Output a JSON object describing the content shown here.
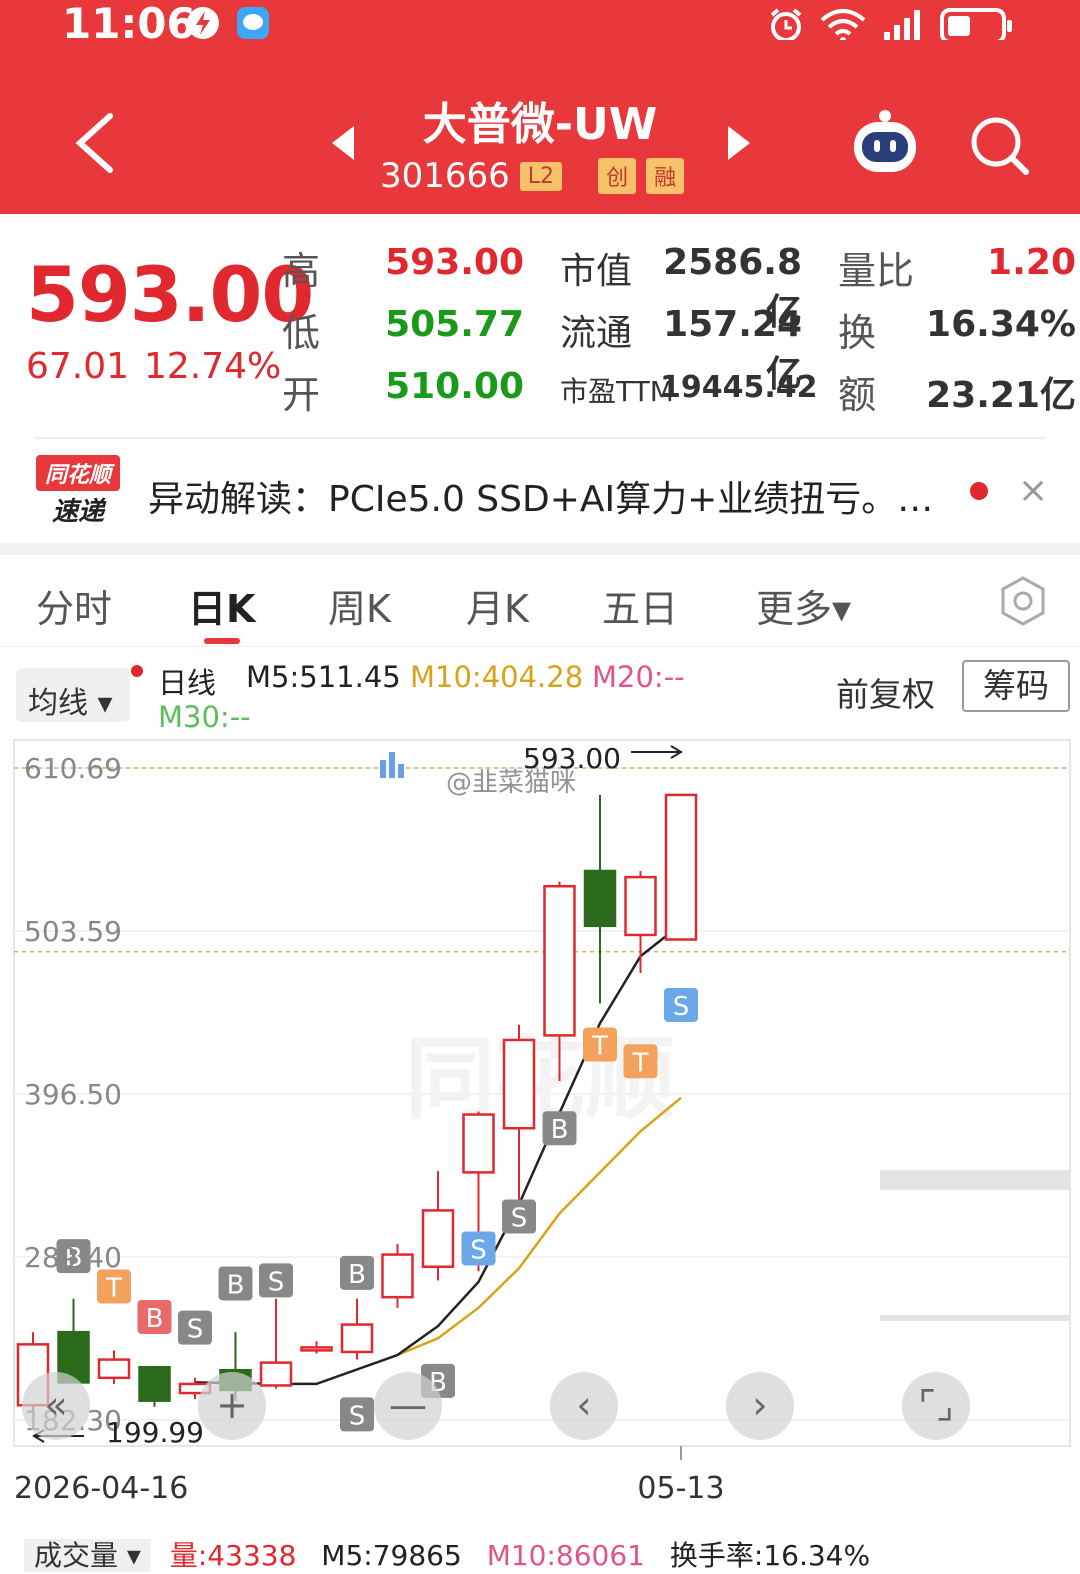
{
  "status": {
    "time": "11:06"
  },
  "header": {
    "title": "大普微-UW",
    "code": "301666",
    "tags": [
      "L2",
      "创",
      "融"
    ]
  },
  "quote": {
    "price": "593.00",
    "change": "67.01",
    "change_pct": "12.74%",
    "rows": [
      {
        "label": "高",
        "value": "593.00",
        "k2": "市值",
        "v2": "2586.8亿",
        "k3": "量比",
        "v3": "1.20"
      },
      {
        "label": "低",
        "value": "505.77",
        "k2": "流通",
        "v2": "157.24亿",
        "k3": "换",
        "v3": "16.34%"
      },
      {
        "label": "开",
        "value": "510.00",
        "k2": "市盈TTM",
        "v2": "19445.42",
        "k3": "额",
        "v3": "23.21亿"
      }
    ]
  },
  "news": {
    "logo_top": "同花顺",
    "logo_bottom": "速递",
    "text": "异动解读：PCIe5.0 SSD+AI算力+业绩扭亏。…",
    "close": "×"
  },
  "tabs": [
    "分时",
    "日K",
    "周K",
    "月K",
    "五日",
    "更多▾"
  ],
  "active_tab": "日K",
  "indicators": {
    "ma_select": "均线 ▾",
    "period": "日线",
    "m5": "M5:511.45",
    "m10": "M10:404.28",
    "m20": "M20:--",
    "m30": "M30:--",
    "adj": "前复权",
    "chip": "筹码",
    "colors": {
      "m5": "#222222",
      "m10": "#d9a21b",
      "m20": "#e0548a",
      "m30": "#5cbd5c"
    }
  },
  "chart_data": {
    "type": "candlestick",
    "y_ticks": [
      "610.69",
      "503.59",
      "396.50",
      "289.40",
      "182.30"
    ],
    "ylim": [
      182.3,
      610.69
    ],
    "x_labels": [
      "2026-04-16",
      "05-13"
    ],
    "high_annotation": "593.00",
    "low_annotation": "199.99",
    "watermark": "@韭菜猫咪",
    "up_color": "#e0282e",
    "down_color": "#2a6a1a",
    "candles": [
      {
        "o": 192,
        "c": 232,
        "h": 240,
        "l": 188
      },
      {
        "o": 240,
        "c": 207,
        "h": 262,
        "l": 207
      },
      {
        "o": 210,
        "c": 222,
        "h": 228,
        "l": 206
      },
      {
        "o": 217,
        "c": 195,
        "h": 217,
        "l": 191
      },
      {
        "o": 200,
        "c": 206,
        "h": 210,
        "l": 196
      },
      {
        "o": 215,
        "c": 202,
        "h": 240,
        "l": 195
      },
      {
        "o": 205,
        "c": 220,
        "h": 262,
        "l": 203
      },
      {
        "o": 230,
        "c": 230,
        "h": 234,
        "l": 226
      },
      {
        "o": 227,
        "c": 245,
        "h": 262,
        "l": 222
      },
      {
        "o": 263,
        "c": 291,
        "h": 298,
        "l": 256
      },
      {
        "o": 283,
        "c": 320,
        "h": 346,
        "l": 274
      },
      {
        "o": 345,
        "c": 383,
        "h": 385,
        "l": 280
      },
      {
        "o": 374,
        "c": 432,
        "h": 442,
        "l": 327
      },
      {
        "o": 435,
        "c": 533,
        "h": 536,
        "l": 405
      },
      {
        "o": 543,
        "c": 507,
        "h": 593,
        "l": 456
      },
      {
        "o": 501,
        "c": 539,
        "h": 543,
        "l": 476
      },
      {
        "o": 498,
        "c": 593,
        "h": 593,
        "l": 505.77
      }
    ],
    "signals": [
      {
        "i": 1,
        "t": "B",
        "price": 290,
        "color": "#888888"
      },
      {
        "i": 2,
        "t": "T",
        "price": 270,
        "color": "#f2a25c"
      },
      {
        "i": 3,
        "t": "B",
        "price": 250,
        "color": "#e86a6a"
      },
      {
        "i": 4,
        "t": "S",
        "price": 243,
        "color": "#888888"
      },
      {
        "i": 5,
        "t": "B",
        "price": 272,
        "color": "#888888"
      },
      {
        "i": 6,
        "t": "S",
        "price": 274,
        "color": "#888888"
      },
      {
        "i": 8,
        "t": "B",
        "price": 279,
        "color": "#888888"
      },
      {
        "i": 8,
        "t": "S",
        "price": 186,
        "color": "#888888"
      },
      {
        "i": 10,
        "t": "B",
        "price": 208,
        "color": "#888888"
      },
      {
        "i": 11,
        "t": "S",
        "price": 295,
        "color": "#6aa8e8"
      },
      {
        "i": 12,
        "t": "S",
        "price": 316,
        "color": "#888888"
      },
      {
        "i": 13,
        "t": "B",
        "price": 374,
        "color": "#888888"
      },
      {
        "i": 14,
        "t": "T",
        "price": 429,
        "color": "#f2a25c"
      },
      {
        "i": 15,
        "t": "T",
        "price": 418,
        "color": "#f2a25c"
      },
      {
        "i": 16,
        "t": "S",
        "price": 455,
        "color": "#6aa8e8"
      }
    ],
    "ma5": [
      [
        4,
        207
      ],
      [
        6,
        206
      ],
      [
        7,
        206
      ],
      [
        9,
        225
      ],
      [
        10,
        244
      ],
      [
        11,
        273
      ],
      [
        12,
        324
      ],
      [
        13,
        384
      ],
      [
        14,
        443
      ],
      [
        15,
        487
      ],
      [
        16,
        508
      ]
    ],
    "ma10": [
      [
        9,
        225
      ],
      [
        10,
        236
      ],
      [
        11,
        256
      ],
      [
        12,
        282
      ],
      [
        13,
        318
      ],
      [
        14,
        345
      ],
      [
        15,
        372
      ],
      [
        16,
        394
      ]
    ]
  },
  "volume_strip": {
    "label": "成交量 ▾",
    "vol": "量:43338",
    "m5": "M5:79865",
    "m10": "M10:86061",
    "turnover": "换手率:16.34%"
  }
}
